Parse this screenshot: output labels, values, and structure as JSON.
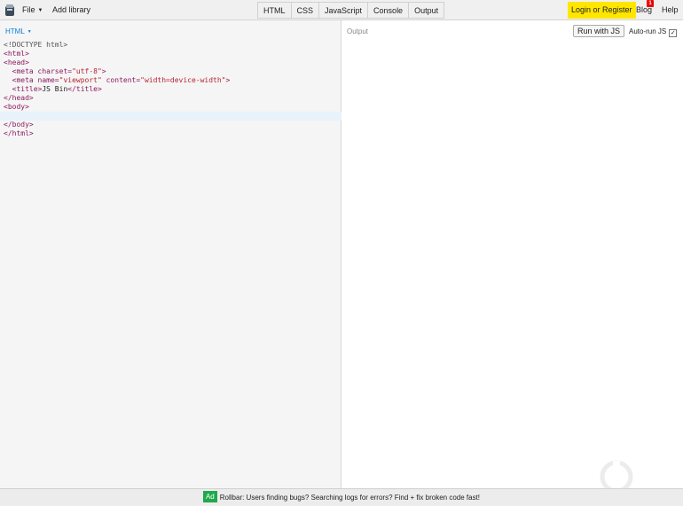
{
  "topbar": {
    "logo_icon": "jsbin-logo-icon",
    "file_label": "File",
    "add_library_label": "Add library",
    "tabs": [
      {
        "label": "HTML",
        "active": true
      },
      {
        "label": "CSS",
        "active": false
      },
      {
        "label": "JavaScript",
        "active": false
      },
      {
        "label": "Console",
        "active": false
      },
      {
        "label": "Output",
        "active": true
      }
    ],
    "login_label": "Login or Register",
    "blog_label": "Blog",
    "blog_badge": "1",
    "help_label": "Help",
    "accent_color": "#ffe600"
  },
  "editor": {
    "panel_label": "HTML",
    "code_lines": [
      "<!DOCTYPE html>",
      "<html>",
      "<head>",
      "  <meta charset=\"utf-8\">",
      "  <meta name=\"viewport\" content=\"width=device-width\">",
      "  <title>JS Bin</title>",
      "</head>",
      "<body>",
      "",
      "</body>",
      "</html>"
    ]
  },
  "output": {
    "panel_label": "Output",
    "run_button_label": "Run with JS",
    "autorun_label": "Auto-run JS",
    "autorun_checked": true
  },
  "footer": {
    "ad_badge": "Ad",
    "ad_text": "Rollbar: Users finding bugs? Searching logs for errors? Find + fix broken code fast!"
  }
}
